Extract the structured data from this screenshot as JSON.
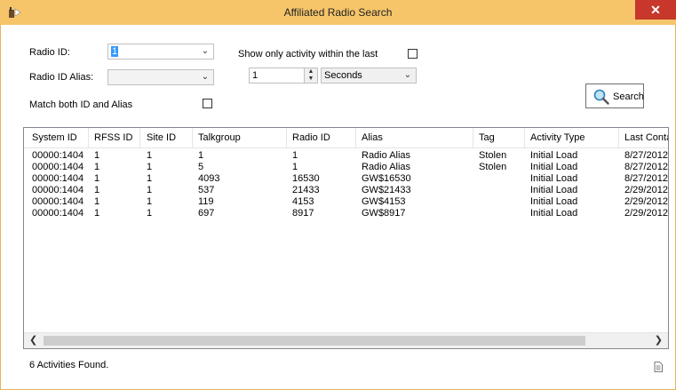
{
  "window": {
    "title": "Affiliated Radio Search",
    "close_symbol": "✕"
  },
  "form": {
    "radio_id_label": "Radio ID:",
    "radio_id_value": "1",
    "radio_alias_label": "Radio ID Alias:",
    "radio_alias_value": "",
    "match_label": "Match both ID and Alias",
    "match_checked": false,
    "activity_label": "Show only activity within the last",
    "activity_checked": false,
    "within_value": "1",
    "unit_value": "Seconds",
    "search_label": "Search"
  },
  "table": {
    "columns": [
      "System ID",
      "RFSS ID",
      "Site ID",
      "Talkgroup",
      "Radio ID",
      "Alias",
      "Tag",
      "Activity Type",
      "Last Conta"
    ],
    "rows": [
      [
        "00000:1404",
        "1",
        "1",
        "1",
        "1",
        "Radio Alias",
        "Stolen",
        "Initial Load",
        "8/27/2012"
      ],
      [
        "00000:1404",
        "1",
        "1",
        "5",
        "1",
        "Radio Alias",
        "Stolen",
        "Initial Load",
        "8/27/2012"
      ],
      [
        "00000:1404",
        "1",
        "1",
        "4093",
        "16530",
        "GW$16530",
        "",
        "Initial Load",
        "8/27/2012"
      ],
      [
        "00000:1404",
        "1",
        "1",
        "537",
        "21433",
        "GW$21433",
        "",
        "Initial Load",
        "2/29/2012"
      ],
      [
        "00000:1404",
        "1",
        "1",
        "119",
        "4153",
        "GW$4153",
        "",
        "Initial Load",
        "2/29/2012"
      ],
      [
        "00000:1404",
        "1",
        "1",
        "697",
        "8917",
        "GW$8917",
        "",
        "Initial Load",
        "2/29/2012"
      ]
    ]
  },
  "status": {
    "text": "6 Activities Found."
  },
  "icons": {
    "app": "app-icon",
    "search": "magnifier-icon",
    "close": "close-icon",
    "export": "document-icon"
  },
  "colors": {
    "titlebar": "#f6c56a",
    "close": "#c7372b",
    "selection": "#3399ff"
  }
}
